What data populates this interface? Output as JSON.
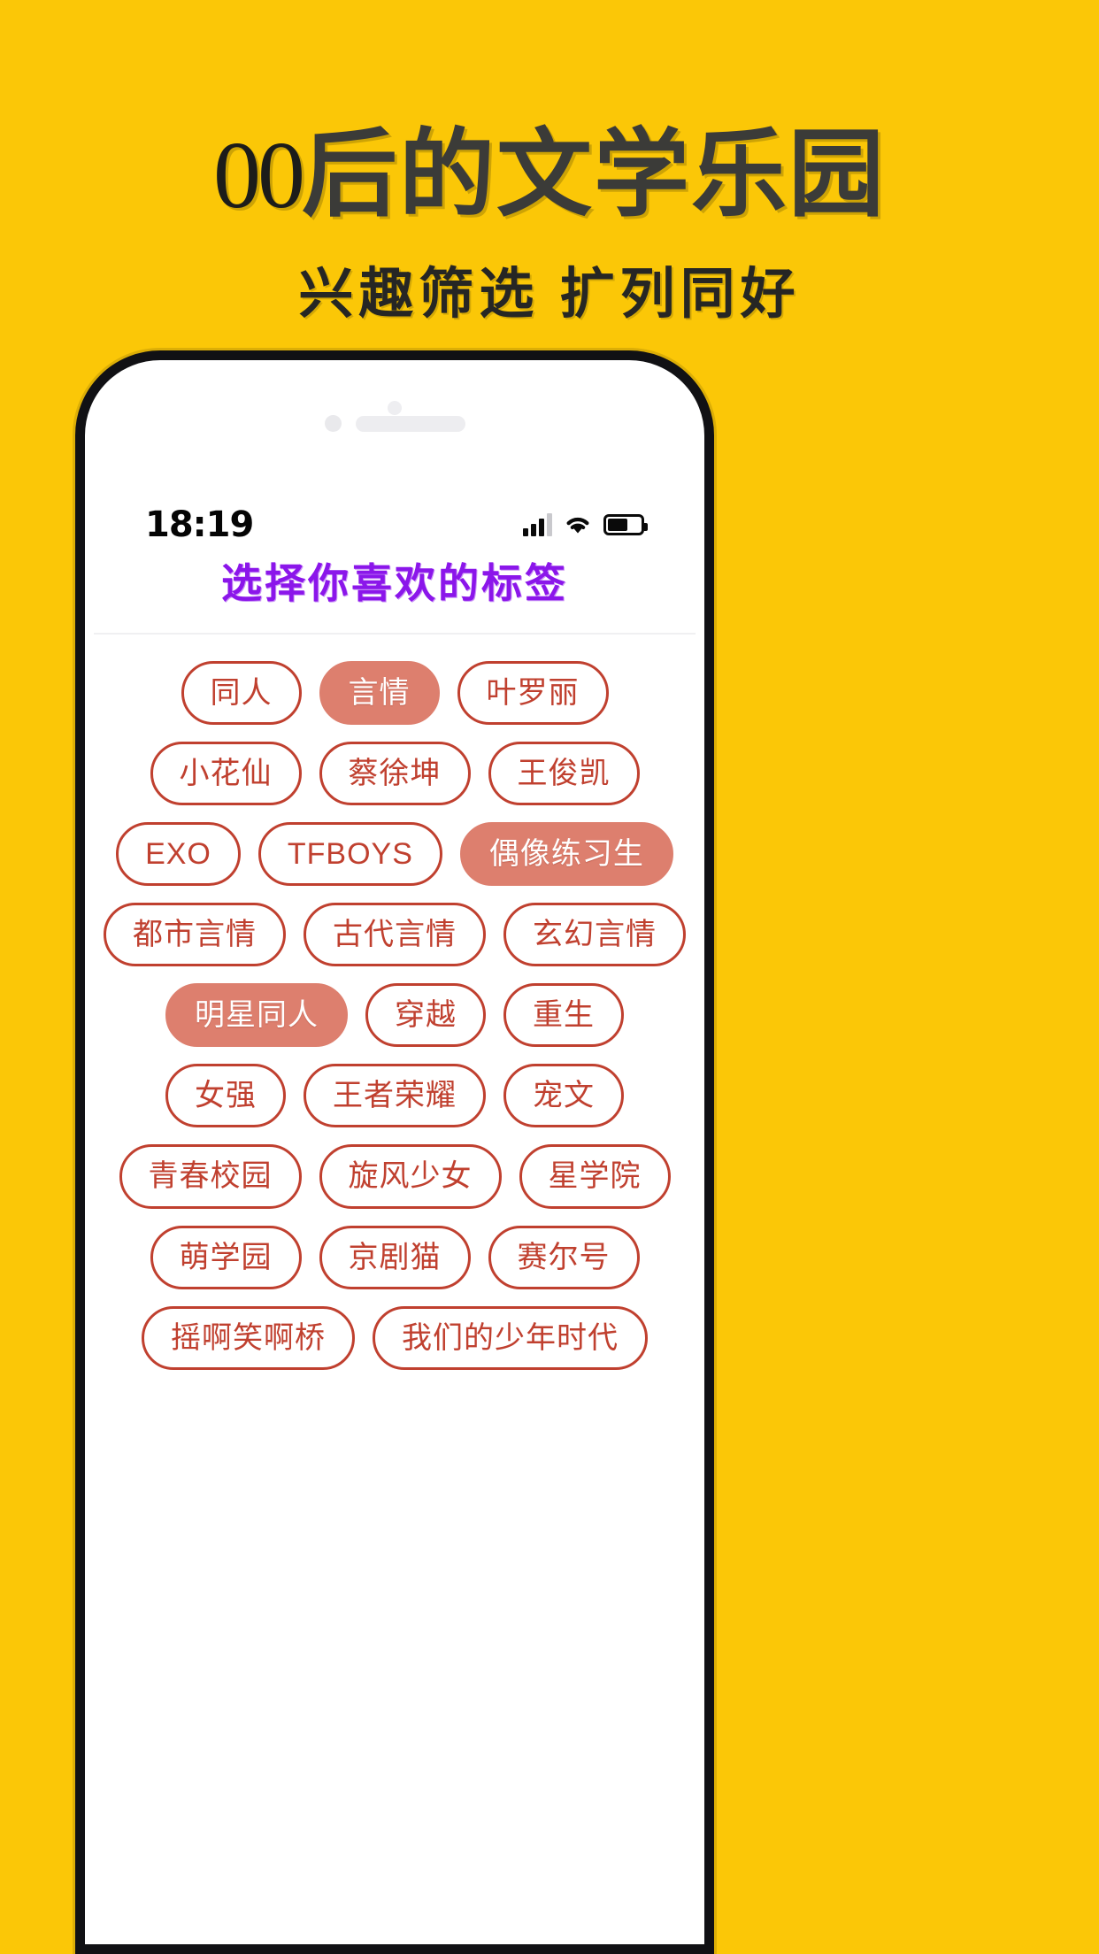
{
  "promo": {
    "headline_prefix": "00",
    "headline_main": "后的文学乐园",
    "subtitle": "兴趣筛选  扩列同好",
    "background_color": "#FBC707",
    "headline_color": "#3b3b38"
  },
  "status_bar": {
    "time": "18:19",
    "signal_icon": "signal-bars-icon",
    "wifi_icon": "wifi-icon",
    "battery_icon": "battery-icon"
  },
  "app": {
    "title": "选择你喜欢的标签",
    "title_color": "#8b16ea",
    "tag_color": "#c0402f",
    "tag_selected_color": "#dd7f6e",
    "tag_rows": [
      [
        {
          "label": "同人",
          "selected": false
        },
        {
          "label": "言情",
          "selected": true
        },
        {
          "label": "叶罗丽",
          "selected": false
        }
      ],
      [
        {
          "label": "小花仙",
          "selected": false
        },
        {
          "label": "蔡徐坤",
          "selected": false
        },
        {
          "label": "王俊凯",
          "selected": false
        }
      ],
      [
        {
          "label": "EXO",
          "selected": false
        },
        {
          "label": "TFBOYS",
          "selected": false
        },
        {
          "label": "偶像练习生",
          "selected": true
        }
      ],
      [
        {
          "label": "都市言情",
          "selected": false
        },
        {
          "label": "古代言情",
          "selected": false
        },
        {
          "label": "玄幻言情",
          "selected": false
        }
      ],
      [
        {
          "label": "明星同人",
          "selected": true
        },
        {
          "label": "穿越",
          "selected": false
        },
        {
          "label": "重生",
          "selected": false
        }
      ],
      [
        {
          "label": "女强",
          "selected": false
        },
        {
          "label": "王者荣耀",
          "selected": false
        },
        {
          "label": "宠文",
          "selected": false
        }
      ],
      [
        {
          "label": "青春校园",
          "selected": false
        },
        {
          "label": "旋风少女",
          "selected": false
        },
        {
          "label": "星学院",
          "selected": false
        }
      ],
      [
        {
          "label": "萌学园",
          "selected": false
        },
        {
          "label": "京剧猫",
          "selected": false
        },
        {
          "label": "赛尔号",
          "selected": false
        }
      ],
      [
        {
          "label": "摇啊笑啊桥",
          "selected": false
        },
        {
          "label": "我们的少年时代",
          "selected": false
        }
      ]
    ]
  }
}
